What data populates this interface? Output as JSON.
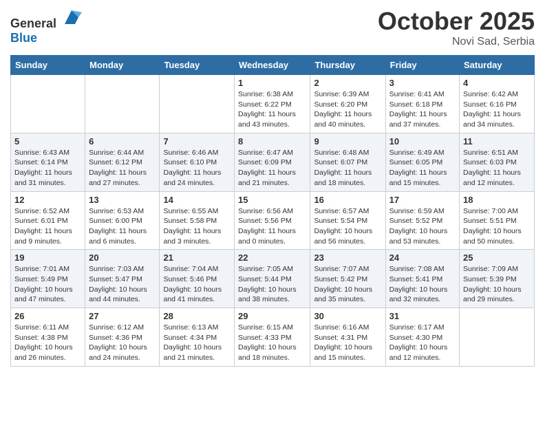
{
  "header": {
    "logo_general": "General",
    "logo_blue": "Blue",
    "month": "October 2025",
    "location": "Novi Sad, Serbia"
  },
  "weekdays": [
    "Sunday",
    "Monday",
    "Tuesday",
    "Wednesday",
    "Thursday",
    "Friday",
    "Saturday"
  ],
  "weeks": [
    [
      {
        "day": "",
        "info": ""
      },
      {
        "day": "",
        "info": ""
      },
      {
        "day": "",
        "info": ""
      },
      {
        "day": "1",
        "info": "Sunrise: 6:38 AM\nSunset: 6:22 PM\nDaylight: 11 hours\nand 43 minutes."
      },
      {
        "day": "2",
        "info": "Sunrise: 6:39 AM\nSunset: 6:20 PM\nDaylight: 11 hours\nand 40 minutes."
      },
      {
        "day": "3",
        "info": "Sunrise: 6:41 AM\nSunset: 6:18 PM\nDaylight: 11 hours\nand 37 minutes."
      },
      {
        "day": "4",
        "info": "Sunrise: 6:42 AM\nSunset: 6:16 PM\nDaylight: 11 hours\nand 34 minutes."
      }
    ],
    [
      {
        "day": "5",
        "info": "Sunrise: 6:43 AM\nSunset: 6:14 PM\nDaylight: 11 hours\nand 31 minutes."
      },
      {
        "day": "6",
        "info": "Sunrise: 6:44 AM\nSunset: 6:12 PM\nDaylight: 11 hours\nand 27 minutes."
      },
      {
        "day": "7",
        "info": "Sunrise: 6:46 AM\nSunset: 6:10 PM\nDaylight: 11 hours\nand 24 minutes."
      },
      {
        "day": "8",
        "info": "Sunrise: 6:47 AM\nSunset: 6:09 PM\nDaylight: 11 hours\nand 21 minutes."
      },
      {
        "day": "9",
        "info": "Sunrise: 6:48 AM\nSunset: 6:07 PM\nDaylight: 11 hours\nand 18 minutes."
      },
      {
        "day": "10",
        "info": "Sunrise: 6:49 AM\nSunset: 6:05 PM\nDaylight: 11 hours\nand 15 minutes."
      },
      {
        "day": "11",
        "info": "Sunrise: 6:51 AM\nSunset: 6:03 PM\nDaylight: 11 hours\nand 12 minutes."
      }
    ],
    [
      {
        "day": "12",
        "info": "Sunrise: 6:52 AM\nSunset: 6:01 PM\nDaylight: 11 hours\nand 9 minutes."
      },
      {
        "day": "13",
        "info": "Sunrise: 6:53 AM\nSunset: 6:00 PM\nDaylight: 11 hours\nand 6 minutes."
      },
      {
        "day": "14",
        "info": "Sunrise: 6:55 AM\nSunset: 5:58 PM\nDaylight: 11 hours\nand 3 minutes."
      },
      {
        "day": "15",
        "info": "Sunrise: 6:56 AM\nSunset: 5:56 PM\nDaylight: 11 hours\nand 0 minutes."
      },
      {
        "day": "16",
        "info": "Sunrise: 6:57 AM\nSunset: 5:54 PM\nDaylight: 10 hours\nand 56 minutes."
      },
      {
        "day": "17",
        "info": "Sunrise: 6:59 AM\nSunset: 5:52 PM\nDaylight: 10 hours\nand 53 minutes."
      },
      {
        "day": "18",
        "info": "Sunrise: 7:00 AM\nSunset: 5:51 PM\nDaylight: 10 hours\nand 50 minutes."
      }
    ],
    [
      {
        "day": "19",
        "info": "Sunrise: 7:01 AM\nSunset: 5:49 PM\nDaylight: 10 hours\nand 47 minutes."
      },
      {
        "day": "20",
        "info": "Sunrise: 7:03 AM\nSunset: 5:47 PM\nDaylight: 10 hours\nand 44 minutes."
      },
      {
        "day": "21",
        "info": "Sunrise: 7:04 AM\nSunset: 5:46 PM\nDaylight: 10 hours\nand 41 minutes."
      },
      {
        "day": "22",
        "info": "Sunrise: 7:05 AM\nSunset: 5:44 PM\nDaylight: 10 hours\nand 38 minutes."
      },
      {
        "day": "23",
        "info": "Sunrise: 7:07 AM\nSunset: 5:42 PM\nDaylight: 10 hours\nand 35 minutes."
      },
      {
        "day": "24",
        "info": "Sunrise: 7:08 AM\nSunset: 5:41 PM\nDaylight: 10 hours\nand 32 minutes."
      },
      {
        "day": "25",
        "info": "Sunrise: 7:09 AM\nSunset: 5:39 PM\nDaylight: 10 hours\nand 29 minutes."
      }
    ],
    [
      {
        "day": "26",
        "info": "Sunrise: 6:11 AM\nSunset: 4:38 PM\nDaylight: 10 hours\nand 26 minutes."
      },
      {
        "day": "27",
        "info": "Sunrise: 6:12 AM\nSunset: 4:36 PM\nDaylight: 10 hours\nand 24 minutes."
      },
      {
        "day": "28",
        "info": "Sunrise: 6:13 AM\nSunset: 4:34 PM\nDaylight: 10 hours\nand 21 minutes."
      },
      {
        "day": "29",
        "info": "Sunrise: 6:15 AM\nSunset: 4:33 PM\nDaylight: 10 hours\nand 18 minutes."
      },
      {
        "day": "30",
        "info": "Sunrise: 6:16 AM\nSunset: 4:31 PM\nDaylight: 10 hours\nand 15 minutes."
      },
      {
        "day": "31",
        "info": "Sunrise: 6:17 AM\nSunset: 4:30 PM\nDaylight: 10 hours\nand 12 minutes."
      },
      {
        "day": "",
        "info": ""
      }
    ]
  ]
}
